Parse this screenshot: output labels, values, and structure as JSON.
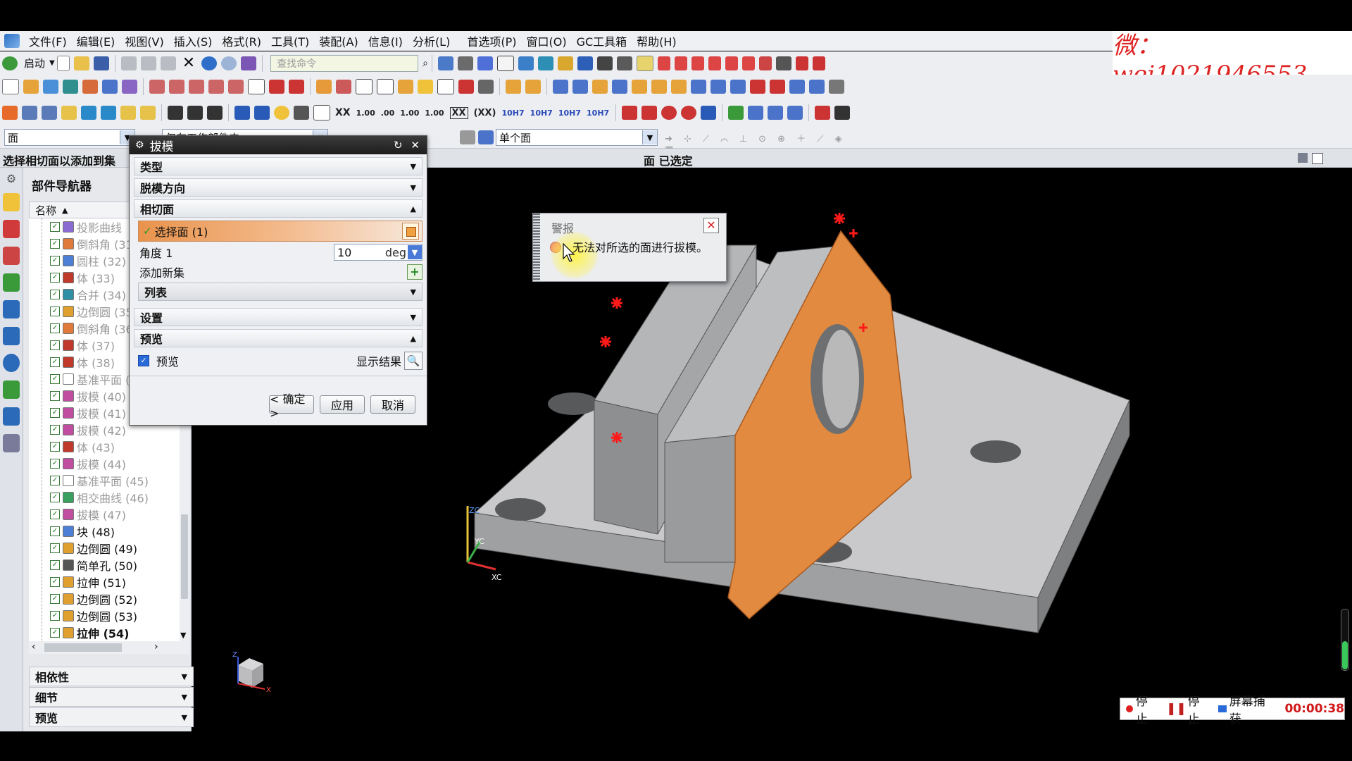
{
  "app": {
    "watermark": "微：wei1021946553",
    "menu": [
      "文件(F)",
      "编辑(E)",
      "视图(V)",
      "插入(S)",
      "格式(R)",
      "工具(T)",
      "装配(A)",
      "信息(I)",
      "分析(L)",
      "首选项(P)",
      "窗口(O)",
      "GC工具箱",
      "帮助(H)"
    ]
  },
  "toolbar": {
    "start_label": "启动",
    "search_placeholder": "查找命令",
    "precision_labels": [
      "1.00",
      ".00",
      "1.00",
      "1.00",
      "XX",
      "(XX)",
      "10H7",
      "10H7",
      "10H7",
      "10H7"
    ],
    "pct_label": "10H7"
  },
  "filterbar": {
    "type_filter": "面",
    "scope_filter": "仅在工作部件内",
    "face_rule": "单个面"
  },
  "status": {
    "prompt": "选择相切面以添加到集",
    "selection": "面 已选定"
  },
  "navigator": {
    "title": "部件导航器",
    "column": "名称",
    "rows": [
      {
        "label": "投影曲线",
        "greyed": true,
        "color": "#8a6bd1"
      },
      {
        "label": "倒斜角 (31)",
        "greyed": true,
        "color": "#e07a3a"
      },
      {
        "label": "圆柱 (32)",
        "greyed": true,
        "color": "#4d7fd6"
      },
      {
        "label": "体 (33)",
        "greyed": true,
        "color": "#c0392b"
      },
      {
        "label": "合并 (34)",
        "greyed": true,
        "color": "#2f8fa4"
      },
      {
        "label": "边倒圆 (35)",
        "greyed": true,
        "color": "#e0a030"
      },
      {
        "label": "倒斜角 (36)",
        "greyed": true,
        "color": "#e07a3a"
      },
      {
        "label": "体 (37)",
        "greyed": true,
        "color": "#c0392b"
      },
      {
        "label": "体 (38)",
        "greyed": true,
        "color": "#c0392b"
      },
      {
        "label": "基准平面 (39)",
        "greyed": true,
        "color": "#ffffff"
      },
      {
        "label": "拔模 (40)",
        "greyed": true,
        "color": "#c04da0"
      },
      {
        "label": "拔模 (41)",
        "greyed": true,
        "color": "#c04da0"
      },
      {
        "label": "拔模 (42)",
        "greyed": true,
        "color": "#c04da0"
      },
      {
        "label": "体 (43)",
        "greyed": true,
        "color": "#c0392b"
      },
      {
        "label": "拔模 (44)",
        "greyed": true,
        "color": "#c04da0"
      },
      {
        "label": "基准平面 (45)",
        "greyed": true,
        "color": "#ffffff"
      },
      {
        "label": "相交曲线 (46)",
        "greyed": true,
        "color": "#3aa060"
      },
      {
        "label": "拔模 (47)",
        "greyed": true,
        "color": "#c04da0"
      },
      {
        "label": "块 (48)",
        "greyed": false,
        "color": "#4d7fd6"
      },
      {
        "label": "边倒圆 (49)",
        "greyed": false,
        "color": "#e0a030"
      },
      {
        "label": "简单孔 (50)",
        "greyed": false,
        "color": "#555555"
      },
      {
        "label": "拉伸 (51)",
        "greyed": false,
        "color": "#e0a030"
      },
      {
        "label": "边倒圆 (52)",
        "greyed": false,
        "color": "#e0a030"
      },
      {
        "label": "边倒圆 (53)",
        "greyed": false,
        "color": "#e0a030"
      },
      {
        "label": "拉伸 (54)",
        "greyed": false,
        "bold": true,
        "color": "#e0a030"
      }
    ],
    "sections": [
      "相依性",
      "细节",
      "预览"
    ]
  },
  "dialog": {
    "title": "拔模",
    "groups": {
      "type": "类型",
      "draw_direction": "脱模方向",
      "tangent_faces": "相切面",
      "settings": "设置",
      "preview": "预览"
    },
    "select_faces": "选择面 (1)",
    "angle_label": "角度 1",
    "angle_value": "10",
    "angle_unit": "deg",
    "add_new_set": "添加新集",
    "list_label": "列表",
    "preview_checkbox": "预览",
    "show_result": "显示结果",
    "buttons": {
      "ok": "< 确定 >",
      "apply": "应用",
      "cancel": "取消"
    }
  },
  "alert": {
    "title": "警报",
    "message": "无法对所选的面进行拔模。"
  },
  "viewport": {
    "triad_labels": {
      "zc": "ZC",
      "yc": "YC",
      "xc": "XC"
    },
    "mini_triad": {
      "z": "Z",
      "x": "X"
    },
    "part_color": "#c9c9cb",
    "face_color": "#e28a3f"
  },
  "recorder": {
    "stop1": "停止",
    "stop2": "停止",
    "capture": "屏幕捕获",
    "timer": "00:00:38"
  }
}
